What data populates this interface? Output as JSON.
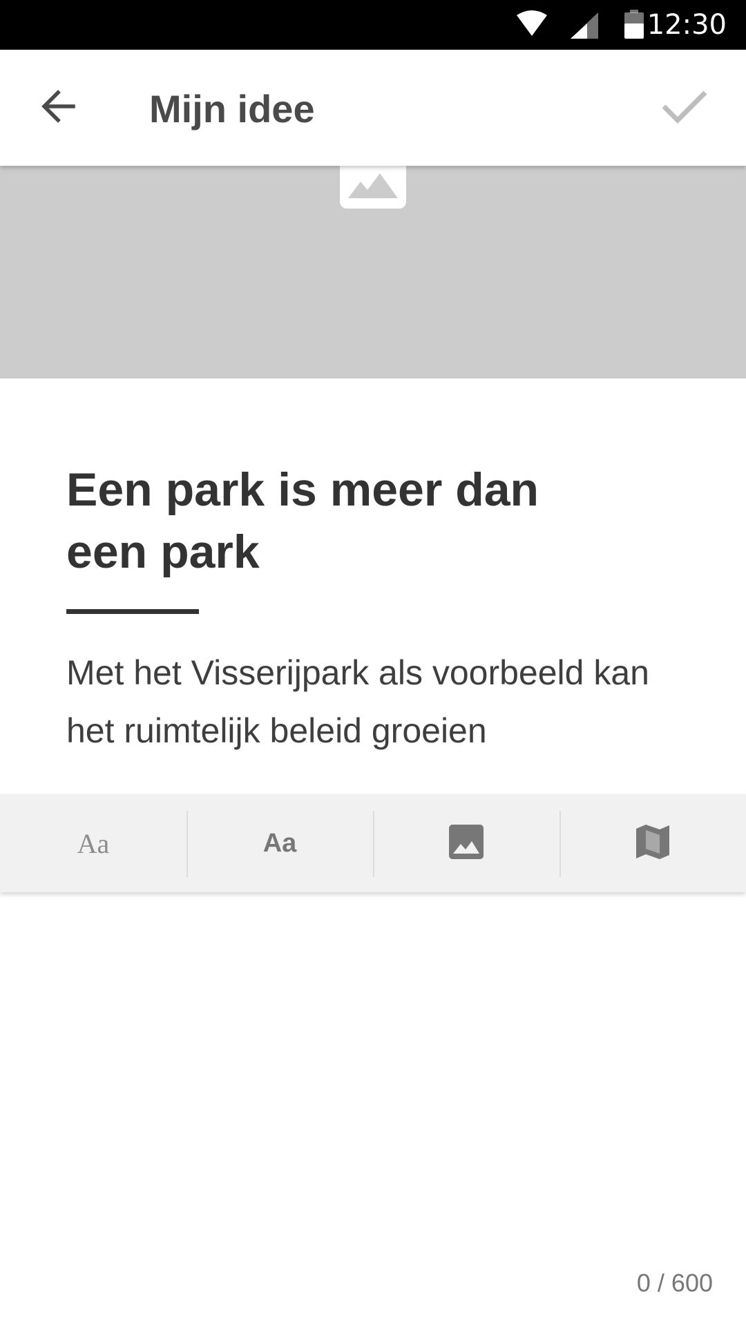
{
  "status_bar": {
    "time": "12:30",
    "icons": [
      "wifi-icon",
      "cell-signal-icon",
      "battery-icon"
    ]
  },
  "app_bar": {
    "back_icon": "arrow-back-icon",
    "title": "Mijn idee",
    "confirm_icon": "check-icon"
  },
  "cover": {
    "icon": "image-placeholder-icon",
    "background_color": "#cccccc"
  },
  "idea": {
    "title": "Een park is meer dan een park",
    "subtitle": "Met het Visserijpark als voorbeeld kan het ruimtelijk beleid groeien"
  },
  "toolbar": {
    "items": [
      {
        "label": "Aa",
        "icon": "serif-text-icon"
      },
      {
        "label": "Aa",
        "icon": "sans-text-icon"
      },
      {
        "icon": "image-icon"
      },
      {
        "icon": "map-icon"
      }
    ]
  },
  "counter": {
    "text": "0 / 600"
  },
  "colors": {
    "status_bar": "#000000",
    "title_text": "#333333",
    "icon_grey": "#777777",
    "toolbar_bg": "#f1f1f1"
  }
}
